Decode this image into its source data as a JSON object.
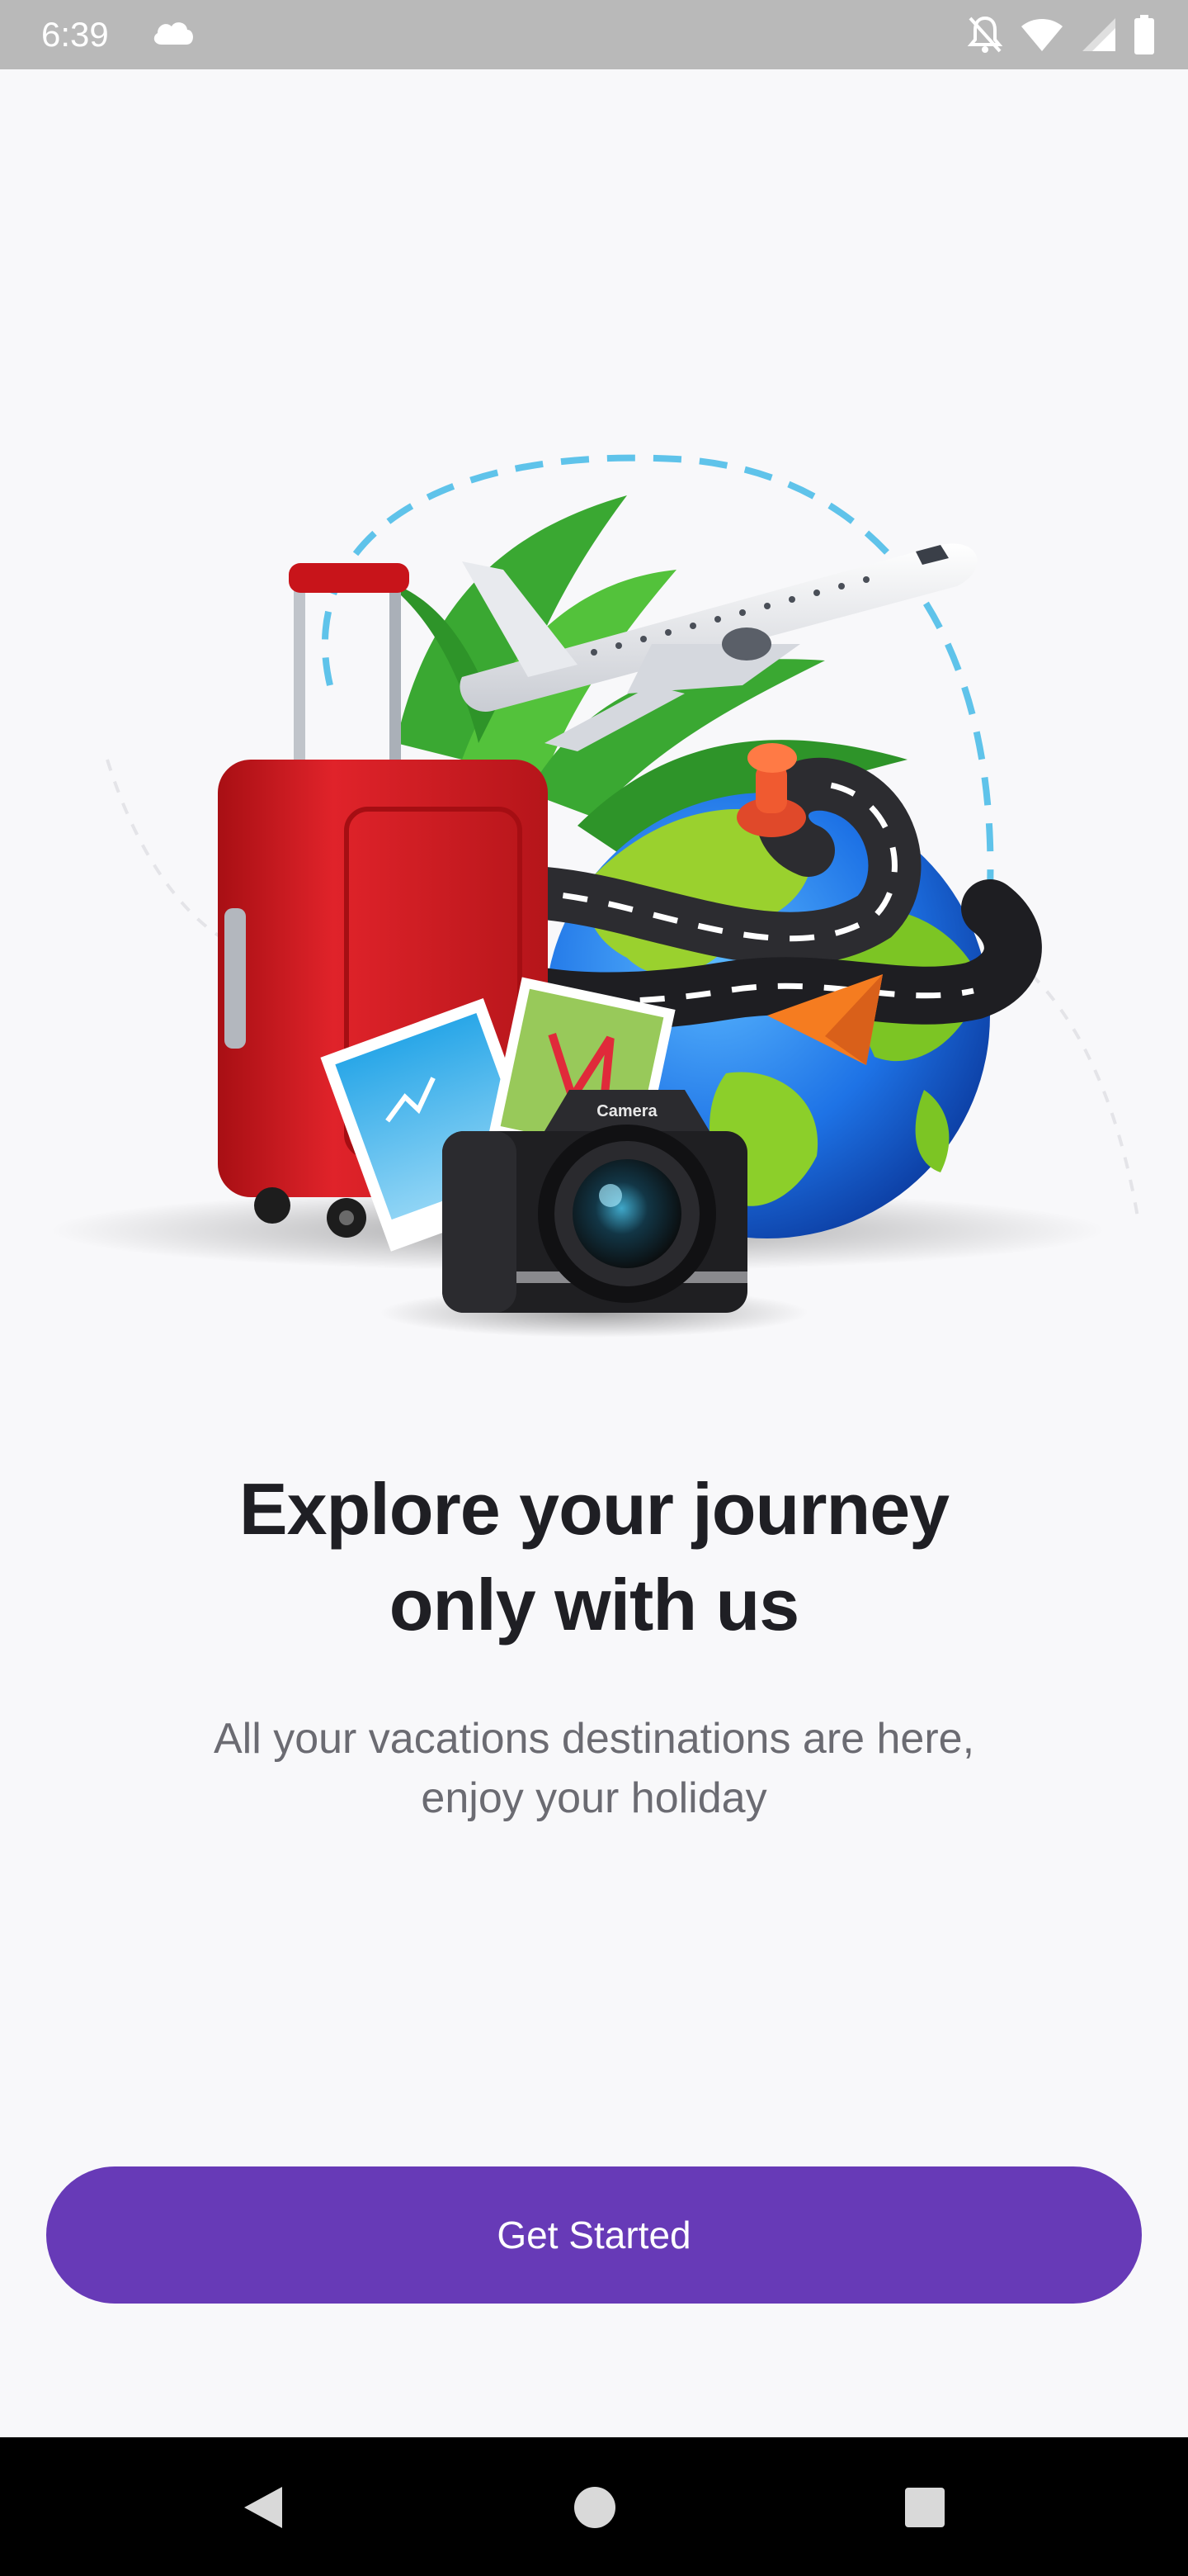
{
  "status_bar": {
    "time": "6:39",
    "left_icons": [
      "cloud-icon"
    ],
    "right_icons": [
      "notifications-off-icon",
      "wifi-icon",
      "signal-icon",
      "battery-icon"
    ]
  },
  "illustration": {
    "camera_label": "Camera",
    "elements": [
      "suitcase",
      "airplane",
      "palm-leaves",
      "globe",
      "road",
      "map-pin",
      "navigation-arrow",
      "photos",
      "camera"
    ]
  },
  "onboarding": {
    "title_line1": "Explore your journey",
    "title_line2": "only with us",
    "subtitle_line1": "All your vacations destinations are here,",
    "subtitle_line2": "enjoy your holiday",
    "cta_label": "Get Started"
  },
  "nav_bar": {
    "icons": [
      "back-icon",
      "home-icon",
      "recents-icon"
    ]
  },
  "colors": {
    "background": "#f8f8fa",
    "accent": "#673ab7",
    "status_bar": "#b9b9b9",
    "title_text": "#1f1f24",
    "subtitle_text": "#6b6b72",
    "nav_bar": "#000000"
  }
}
